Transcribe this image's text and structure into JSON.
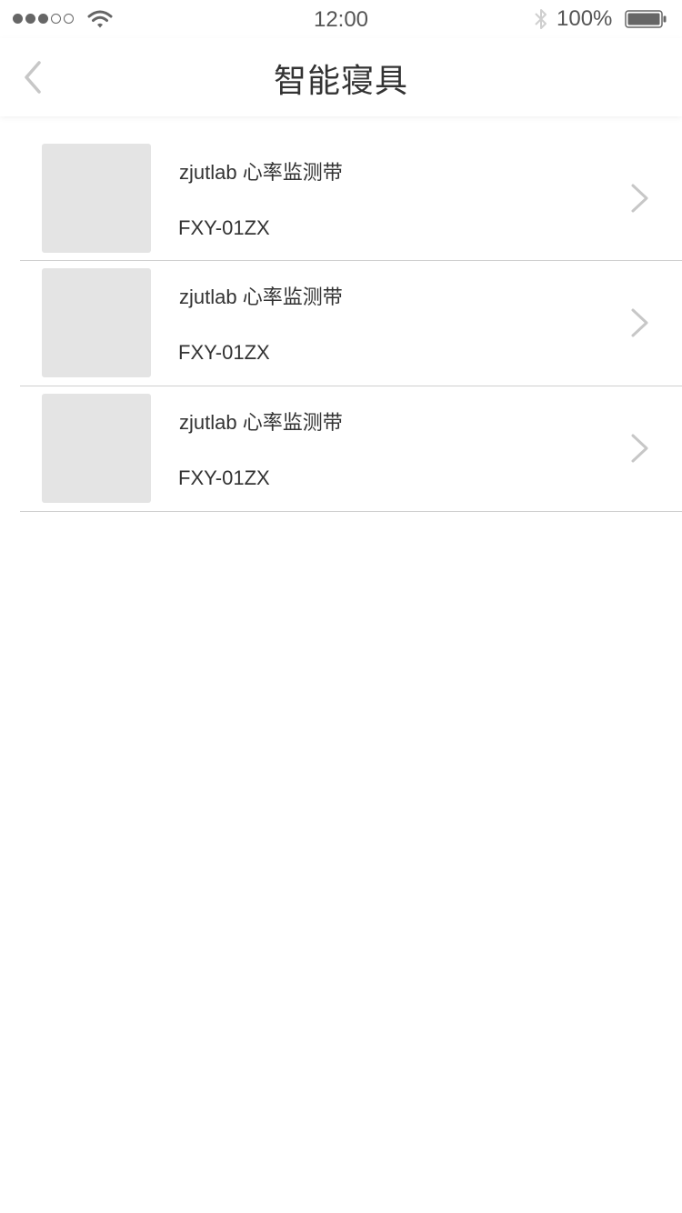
{
  "status_bar": {
    "time": "12:00",
    "battery_percent": "100%",
    "signal_bars_filled": 3,
    "signal_bars_total": 5
  },
  "nav": {
    "title": "智能寝具",
    "back_icon": "chevron-left-icon"
  },
  "devices": [
    {
      "name": "zjutlab 心率监测带",
      "model": "FXY-01ZX"
    },
    {
      "name": "zjutlab 心率监测带",
      "model": "FXY-01ZX"
    },
    {
      "name": "zjutlab 心率监测带",
      "model": "FXY-01ZX"
    }
  ],
  "colors": {
    "text": "#333333",
    "thumb_placeholder": "#e4e4e4",
    "divider": "#cfcfcf",
    "chevron": "#c7c7c7"
  }
}
